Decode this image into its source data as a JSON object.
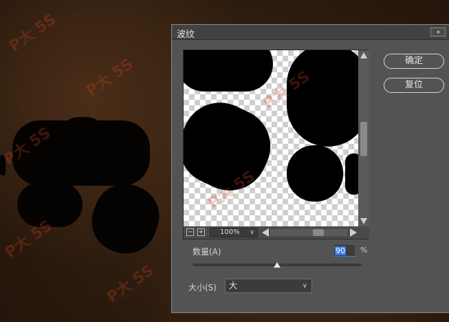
{
  "dialog": {
    "title": "波纹",
    "ok_label": "确定",
    "reset_label": "复位"
  },
  "preview": {
    "zoom_out_label": "−",
    "zoom_in_label": "+",
    "zoom_value": "100%"
  },
  "amount": {
    "label": "数量(A)",
    "value": "90",
    "unit": "%",
    "slider_fraction": 0.5
  },
  "size": {
    "label": "大小(S)",
    "selected": "大"
  },
  "watermark": {
    "text": "P大 5S"
  }
}
